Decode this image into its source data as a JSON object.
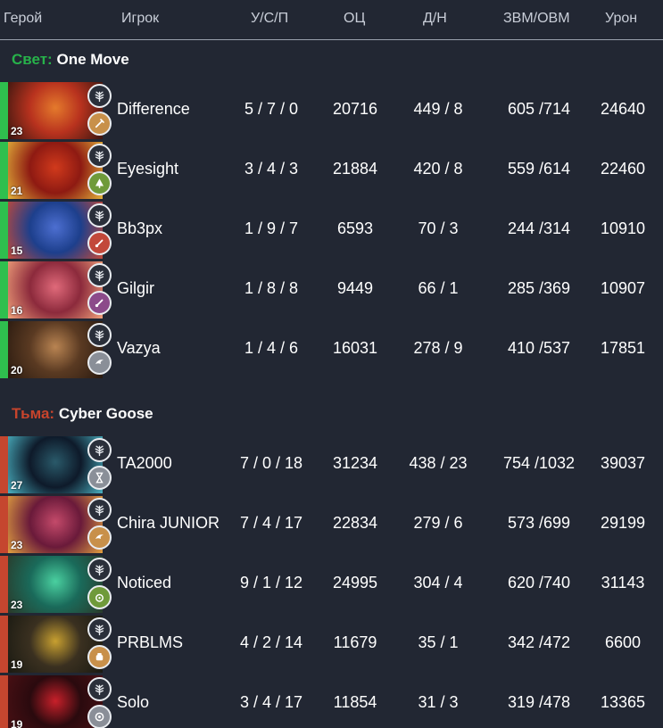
{
  "headers": {
    "hero": "Герой",
    "player": "Игрок",
    "kda": "У/С/П",
    "networth": "ОЦ",
    "lh_dn": "Д/Н",
    "gpm_xpm": "ЗВМ/ОВМ",
    "damage": "Урон"
  },
  "teams": [
    {
      "prefix": "Свет:",
      "name": "One Move",
      "accent": "#2fbf4e",
      "players": [
        {
          "level": "23",
          "player": "Difference",
          "kda": "5 / 7 / 0",
          "networth": "20716",
          "lh_dn": "449 / 8",
          "gpm_xpm": "605 /714",
          "damage": "24640",
          "portrait_colors": [
            "#b8321e",
            "#e47a2c",
            "#3a1610"
          ],
          "role_color": "#c8904a",
          "role_icon": "carry-sword-icon"
        },
        {
          "level": "21",
          "player": "Eyesight",
          "kda": "3 / 4 / 3",
          "networth": "21884",
          "lh_dn": "420 / 8",
          "gpm_xpm": "559 /614",
          "damage": "22460",
          "portrait_colors": [
            "#8e1a12",
            "#d13a1c",
            "#e2b13a"
          ],
          "role_color": "#6f9a3a",
          "role_icon": "offlane-tree-icon"
        },
        {
          "level": "15",
          "player": "Bb3px",
          "kda": "1 / 9 / 7",
          "networth": "6593",
          "lh_dn": "70 / 3",
          "gpm_xpm": "244 /314",
          "damage": "10910",
          "portrait_colors": [
            "#1d3f8c",
            "#4d6fd1",
            "#c24a3a"
          ],
          "role_color": "#c2483a",
          "role_icon": "support-flask-icon"
        },
        {
          "level": "16",
          "player": "Gilgir",
          "kda": "1 / 8 / 8",
          "networth": "9449",
          "lh_dn": "66 / 1",
          "gpm_xpm": "285 /369",
          "damage": "10907",
          "portrait_colors": [
            "#8c2a3c",
            "#e06a7a",
            "#f0a07a"
          ],
          "role_color": "#8c4a8a",
          "role_icon": "support-flask-icon"
        },
        {
          "level": "20",
          "player": "Vazya",
          "kda": "1 / 4 / 6",
          "networth": "16031",
          "lh_dn": "278 / 9",
          "gpm_xpm": "410 /537",
          "damage": "17851",
          "portrait_colors": [
            "#5a3a22",
            "#b98452",
            "#2a1a10"
          ],
          "role_color": "#8a8f98",
          "role_icon": "roam-wind-icon"
        }
      ]
    },
    {
      "prefix": "Тьма:",
      "name": "Cyber Goose",
      "accent": "#c5462f",
      "players": [
        {
          "level": "27",
          "player": "TA2000",
          "kda": "7 / 0 / 18",
          "networth": "31234",
          "lh_dn": "438 / 23",
          "gpm_xpm": "754 /1032",
          "damage": "39037",
          "portrait_colors": [
            "#0e1a2a",
            "#2a5a6a",
            "#4ab0c0"
          ],
          "role_color": "#8a8f98",
          "role_icon": "hourglass-icon"
        },
        {
          "level": "23",
          "player": "Chira JUNIOR",
          "kda": "7 / 4 / 17",
          "networth": "22834",
          "lh_dn": "279 / 6",
          "gpm_xpm": "573 /699",
          "damage": "29199",
          "portrait_colors": [
            "#6a1a3a",
            "#c44a6a",
            "#e0a040"
          ],
          "role_color": "#c8904a",
          "role_icon": "roam-wind-icon"
        },
        {
          "level": "23",
          "player": "Noticed",
          "kda": "9 / 1 / 12",
          "networth": "24995",
          "lh_dn": "304 / 4",
          "gpm_xpm": "620 /740",
          "damage": "31143",
          "portrait_colors": [
            "#1a6a5a",
            "#4ad0a0",
            "#2a3a2a"
          ],
          "role_color": "#6f9a3a",
          "role_icon": "nuker-swirl-icon"
        },
        {
          "level": "19",
          "player": "PRBLMS",
          "kda": "4 / 2 / 14",
          "networth": "11679",
          "lh_dn": "35 / 1",
          "gpm_xpm": "342 /472",
          "damage": "6600",
          "portrait_colors": [
            "#3a3020",
            "#c8a030",
            "#1a1a12"
          ],
          "role_color": "#c8904a",
          "role_icon": "pusher-fist-icon"
        },
        {
          "level": "19",
          "player": "Solo",
          "kda": "3 / 4 / 17",
          "networth": "11854",
          "lh_dn": "31 / 3",
          "gpm_xpm": "319 /478",
          "damage": "13365",
          "portrait_colors": [
            "#2a0a0e",
            "#c8202a",
            "#4a1014"
          ],
          "role_color": "#8a8f98",
          "role_icon": "disabler-eye-icon"
        }
      ]
    }
  ]
}
